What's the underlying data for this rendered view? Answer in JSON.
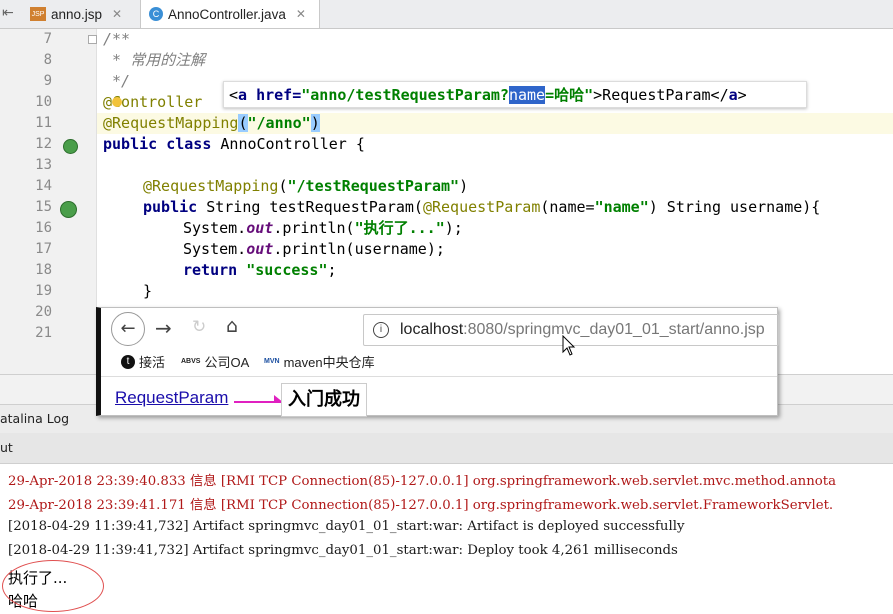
{
  "tabs": [
    {
      "icon": "jsp-file-icon",
      "badge": "JSP",
      "label": "anno.jsp"
    },
    {
      "icon": "java-class-icon",
      "badge": "C",
      "label": "AnnoController.java"
    }
  ],
  "gutter": {
    "line_numbers": [
      "7",
      "8",
      "9",
      "10",
      "11",
      "12",
      "13",
      "14",
      "15",
      "16",
      "17",
      "18",
      "19",
      "20",
      "21"
    ]
  },
  "code": {
    "l7": "/**",
    "l8": " * 常用的注解",
    "l9": " */",
    "l10": "@Controller",
    "l11_ann": "@RequestMapping",
    "l11_str": "\"/anno\"",
    "l12_kw": "public class",
    "l12_rest": " AnnoController {",
    "l14_ann": "@RequestMapping",
    "l14_str": "\"/testRequestParam\"",
    "l15_kw": "public",
    "l15_a": " String testRequestParam(",
    "l15_ann": "@RequestParam",
    "l15_b": "(name=",
    "l15_str": "\"name\"",
    "l15_c": ") String username){",
    "l16_a": "System.",
    "l16_it": "out",
    "l16_b": ".println(",
    "l16_str": "\"执行了...\"",
    "l16_c": ");",
    "l17_a": "System.",
    "l17_it": "out",
    "l17_b": ".println(username);",
    "l18_kw": "return",
    "l18_str": "\"success\"",
    "l18_c": ";",
    "l19": "}"
  },
  "tooltip": {
    "p1": "<",
    "tag": "a",
    "attr": " href=",
    "val1": "\"anno/testRequestParam?",
    "sel": "name",
    "val2": "=哈哈\"",
    "p2": ">RequestParam</",
    "tag2": "a",
    "p3": ">"
  },
  "browser": {
    "url_host": "localhost",
    "url_path": ":8080/springmvc_day01_01_start/anno.jsp",
    "bookmarks": [
      "接活",
      "公司OA",
      "maven中央仓库"
    ],
    "bookmark_badges": [
      "ABVS",
      "MVN"
    ],
    "link": "RequestParam"
  },
  "note": "入门成功",
  "panels": {
    "catalina": "atalina Log",
    "output": "ut"
  },
  "console": {
    "lines": [
      {
        "kind": "red",
        "text": "29-Apr-2018 23:39:40.833 信息 [RMI TCP Connection(85)-127.0.0.1] org.springframework.web.servlet.mvc.method.annota"
      },
      {
        "kind": "red",
        "text": "29-Apr-2018 23:39:41.171 信息 [RMI TCP Connection(85)-127.0.0.1] org.springframework.web.servlet.FrameworkServlet."
      },
      {
        "kind": "plain",
        "text": "[2018-04-29 11:39:41,732] Artifact springmvc_day01_01_start:war: Artifact is deployed successfully"
      },
      {
        "kind": "plain",
        "text": "[2018-04-29 11:39:41,732] Artifact springmvc_day01_01_start:war: Deploy took 4,261 milliseconds"
      }
    ],
    "out1": "执行了...",
    "out2": "哈哈"
  }
}
